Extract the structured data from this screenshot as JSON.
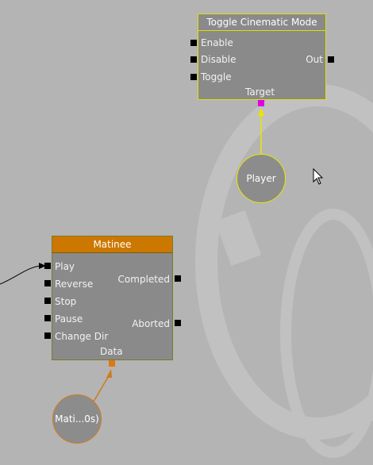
{
  "colors": {
    "background": "#b4b4b4",
    "node_body": "#8a8a8a",
    "toggle_border": "#e0e000",
    "matinee_title_bg": "#cc7700",
    "matinee_border": "#7a7a2a",
    "target_connector": "#e000e0",
    "data_connector": "#e07810",
    "link_yellow": "#e6e600",
    "link_orange": "#d07a1a"
  },
  "toggle_node": {
    "title": "Toggle Cinematic Mode",
    "inputs": [
      "Enable",
      "Disable",
      "Toggle"
    ],
    "output": "Out",
    "variable_label": "Target"
  },
  "player_var": {
    "label": "Player"
  },
  "matinee_node": {
    "title": "Matinee",
    "inputs": [
      "Play",
      "Reverse",
      "Stop",
      "Pause",
      "Change Dir"
    ],
    "outputs": [
      "Completed",
      "Aborted"
    ],
    "variable_label": "Data"
  },
  "matinee_var": {
    "label": "Mati...0s)"
  },
  "cursor": {
    "icon": "mouse-pointer-icon"
  }
}
